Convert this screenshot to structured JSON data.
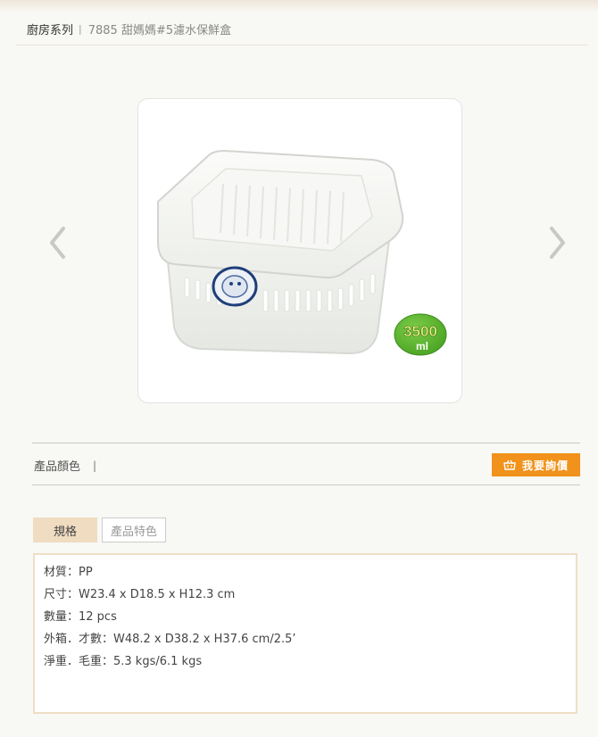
{
  "breadcrumb": {
    "category": "廚房系列",
    "separator": "|",
    "current": "7885 甜媽媽#5濾水保鮮盒"
  },
  "gallery": {
    "prev_icon": "chevron-left-icon",
    "next_icon": "chevron-right-icon",
    "product_image": {
      "badge_value": "3500",
      "badge_unit": "ml"
    }
  },
  "colors": {
    "label": "產品顏色",
    "separator": "|"
  },
  "inquire": {
    "icon": "basket-icon",
    "label": "我要詢價"
  },
  "tabs": [
    {
      "label": "規格",
      "active": true
    },
    {
      "label": "產品特色",
      "active": false
    }
  ],
  "specs": [
    "材質：PP",
    "尺寸：W23.4 x D18.5 x H12.3 cm",
    "數量：12 pcs",
    "外箱．才數：W48.2 x D38.2 x H37.6 cm/2.5’",
    "淨重．毛重：5.3 kgs/6.1 kgs"
  ],
  "theme": {
    "accent": "#f0921b",
    "tab_active_bg": "#f0dcc1",
    "badge_green": "#5cb531"
  }
}
